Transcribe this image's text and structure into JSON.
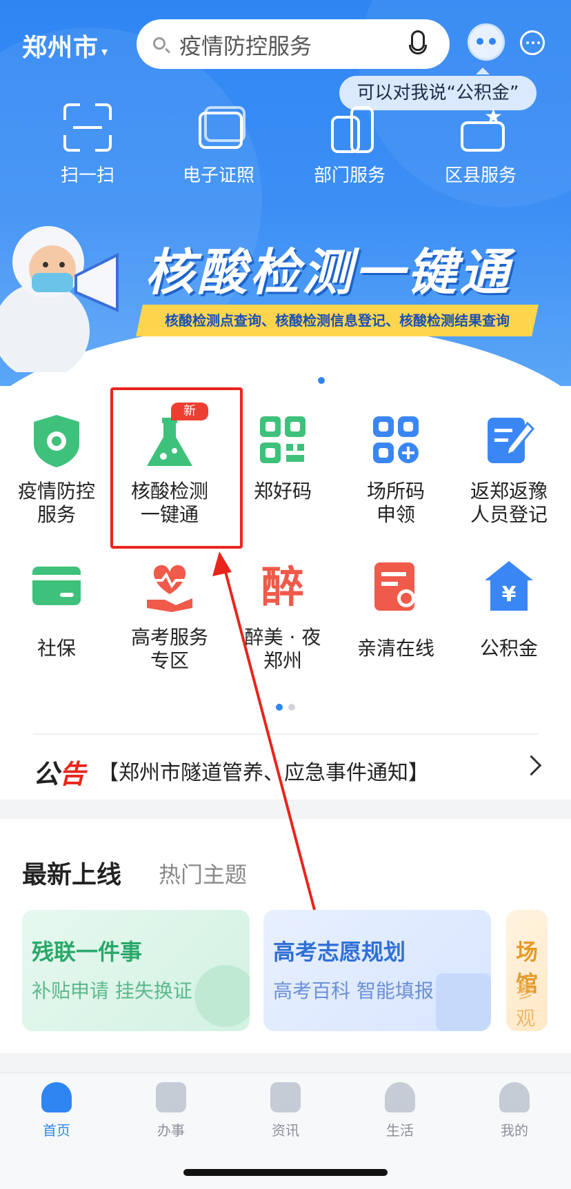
{
  "header": {
    "city": "郑州市",
    "search_placeholder": "疫情防控服务",
    "tooltip": "可以对我说“公积金”"
  },
  "top_icons": [
    {
      "label": "扫一扫",
      "icon": "scan-icon"
    },
    {
      "label": "电子证照",
      "icon": "id-card-icon"
    },
    {
      "label": "部门服务",
      "icon": "department-icon"
    },
    {
      "label": "区县服务",
      "icon": "district-icon"
    }
  ],
  "banner": {
    "title": "核酸检测一键通",
    "subtitle": "核酸检测点查询、核酸检测信息登记、核酸检测结果查询"
  },
  "grid": [
    {
      "label": "疫情防控\n服务",
      "icon": "shield-virus-icon",
      "color": "#3ec17a"
    },
    {
      "label": "核酸检测\n一键通",
      "icon": "flask-icon",
      "color": "#3ec17a",
      "badge": "新"
    },
    {
      "label": "郑好码",
      "icon": "qr-code-icon",
      "color": "#3ec17a"
    },
    {
      "label": "场所码\n申领",
      "icon": "apps-plus-icon",
      "color": "#3b86f5"
    },
    {
      "label": "返郑返豫\n人员登记",
      "icon": "edit-note-icon",
      "color": "#3b86f5"
    },
    {
      "label": "社保",
      "icon": "card-icon",
      "color": "#3ec17a"
    },
    {
      "label": "高考服务\n专区",
      "icon": "heart-hand-icon",
      "color": "#f05a4a"
    },
    {
      "label": "醉美 · 夜\n郑州",
      "icon": "zui-character-icon",
      "color": "#f05a4a"
    },
    {
      "label": "亲清在线",
      "icon": "certificate-icon",
      "color": "#f05a4a"
    },
    {
      "label": "公积金",
      "icon": "house-yuan-icon",
      "color": "#3b86f5"
    }
  ],
  "notice": {
    "tag_a": "公",
    "tag_b": "告",
    "text": "【郑州市隧道管养、应急事件通知】"
  },
  "latest": {
    "tab_active": "最新上线",
    "tab_other": "热门主题",
    "cards": [
      {
        "title": "残联一件事",
        "subtitle": "补贴申请 挂失换证",
        "color": "#2aa86a"
      },
      {
        "title": "高考志愿规划",
        "subtitle": "高考百科 智能填报",
        "color": "#2f6fd6"
      },
      {
        "title": "场馆",
        "subtitle": "参观",
        "color": "#e59a2b"
      }
    ]
  },
  "tabbar": [
    {
      "label": "首页",
      "icon": "home-icon",
      "active": true
    },
    {
      "label": "办事",
      "icon": "clock-icon",
      "active": false
    },
    {
      "label": "资讯",
      "icon": "news-icon",
      "active": false
    },
    {
      "label": "生活",
      "icon": "heart-icon",
      "active": false
    },
    {
      "label": "我的",
      "icon": "user-icon",
      "active": false
    }
  ]
}
